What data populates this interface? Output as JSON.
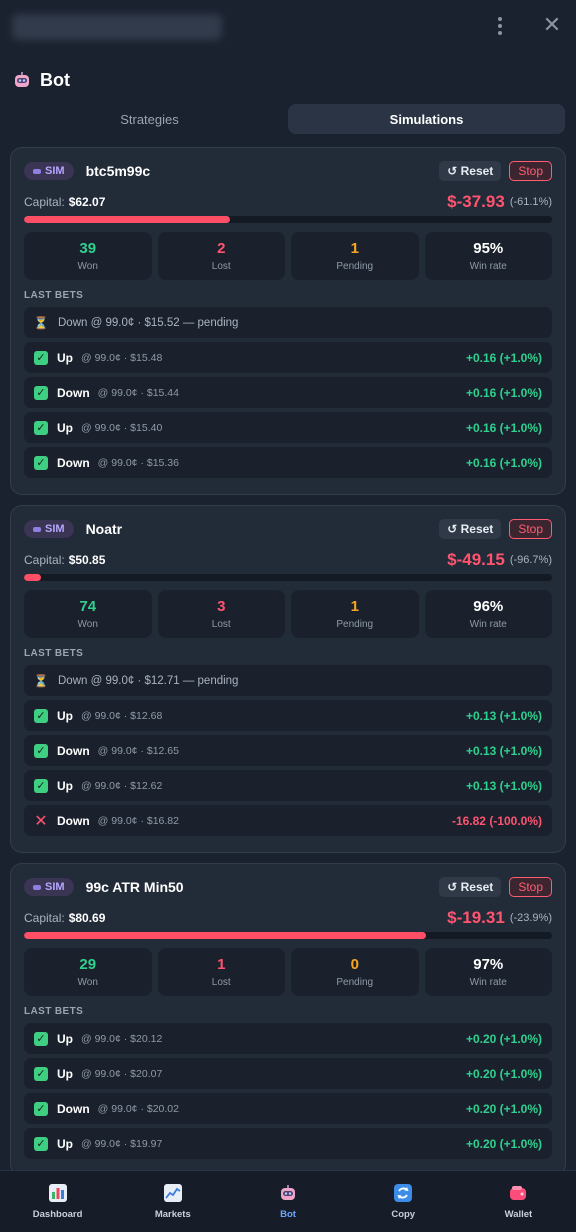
{
  "header": {
    "bot_title": "Bot"
  },
  "tabs": [
    {
      "label": "Strategies",
      "active": false
    },
    {
      "label": "Simulations",
      "active": true
    }
  ],
  "colors": {
    "win": "#2fd18f",
    "loss": "#ff5470",
    "pending": "#f5a623",
    "accent": "#6aa8ff"
  },
  "simulations": [
    {
      "badge": "SIM",
      "name": "btc5m99c",
      "reset_label": "↺ Reset",
      "stop_label": "Stop",
      "capital_label": "Capital:",
      "capital_value": "$62.07",
      "pnl": "$-37.93",
      "pnl_pct": "(-61.1%)",
      "capital_fraction": 0.39,
      "stats": [
        {
          "value": "39",
          "label": "Won"
        },
        {
          "value": "2",
          "label": "Lost"
        },
        {
          "value": "1",
          "label": "Pending"
        },
        {
          "value": "95%",
          "label": "Win rate"
        }
      ],
      "last_bets_label": "LAST BETS",
      "bets": [
        {
          "status": "pending",
          "text": "Down @ 99.0¢ · $15.52 — pending"
        },
        {
          "status": "win",
          "side": "Up",
          "detail": "@ 99.0¢ · $15.48",
          "result": "+0.16 (+1.0%)"
        },
        {
          "status": "win",
          "side": "Down",
          "detail": "@ 99.0¢ · $15.44",
          "result": "+0.16 (+1.0%)"
        },
        {
          "status": "win",
          "side": "Up",
          "detail": "@ 99.0¢ · $15.40",
          "result": "+0.16 (+1.0%)"
        },
        {
          "status": "win",
          "side": "Down",
          "detail": "@ 99.0¢ · $15.36",
          "result": "+0.16 (+1.0%)"
        }
      ]
    },
    {
      "badge": "SIM",
      "name": "Noatr",
      "reset_label": "↺ Reset",
      "stop_label": "Stop",
      "capital_label": "Capital:",
      "capital_value": "$50.85",
      "pnl": "$-49.15",
      "pnl_pct": "(-96.7%)",
      "capital_fraction": 0.033,
      "stats": [
        {
          "value": "74",
          "label": "Won"
        },
        {
          "value": "3",
          "label": "Lost"
        },
        {
          "value": "1",
          "label": "Pending"
        },
        {
          "value": "96%",
          "label": "Win rate"
        }
      ],
      "last_bets_label": "LAST BETS",
      "bets": [
        {
          "status": "pending",
          "text": "Down @ 99.0¢ · $12.71 — pending"
        },
        {
          "status": "win",
          "side": "Up",
          "detail": "@ 99.0¢ · $12.68",
          "result": "+0.13 (+1.0%)"
        },
        {
          "status": "win",
          "side": "Down",
          "detail": "@ 99.0¢ · $12.65",
          "result": "+0.13 (+1.0%)"
        },
        {
          "status": "win",
          "side": "Up",
          "detail": "@ 99.0¢ · $12.62",
          "result": "+0.13 (+1.0%)"
        },
        {
          "status": "loss",
          "side": "Down",
          "detail": "@ 99.0¢ · $16.82",
          "result": "-16.82 (-100.0%)"
        }
      ]
    },
    {
      "badge": "SIM",
      "name": "99c ATR Min50",
      "reset_label": "↺ Reset",
      "stop_label": "Stop",
      "capital_label": "Capital:",
      "capital_value": "$80.69",
      "pnl": "$-19.31",
      "pnl_pct": "(-23.9%)",
      "capital_fraction": 0.761,
      "stats": [
        {
          "value": "29",
          "label": "Won"
        },
        {
          "value": "1",
          "label": "Lost"
        },
        {
          "value": "0",
          "label": "Pending"
        },
        {
          "value": "97%",
          "label": "Win rate"
        }
      ],
      "last_bets_label": "LAST BETS",
      "bets": [
        {
          "status": "win",
          "side": "Up",
          "detail": "@ 99.0¢ · $20.12",
          "result": "+0.20 (+1.0%)"
        },
        {
          "status": "win",
          "side": "Up",
          "detail": "@ 99.0¢ · $20.07",
          "result": "+0.20 (+1.0%)"
        },
        {
          "status": "win",
          "side": "Down",
          "detail": "@ 99.0¢ · $20.02",
          "result": "+0.20 (+1.0%)"
        },
        {
          "status": "win",
          "side": "Up",
          "detail": "@ 99.0¢ · $19.97",
          "result": "+0.20 (+1.0%)"
        }
      ]
    }
  ],
  "bottom_nav": [
    {
      "label": "Dashboard",
      "icon": "bar-chart-icon",
      "active": false
    },
    {
      "label": "Markets",
      "icon": "line-chart-icon",
      "active": false
    },
    {
      "label": "Bot",
      "icon": "robot-icon",
      "active": true
    },
    {
      "label": "Copy",
      "icon": "refresh-icon",
      "active": false
    },
    {
      "label": "Wallet",
      "icon": "wallet-icon",
      "active": false
    }
  ]
}
